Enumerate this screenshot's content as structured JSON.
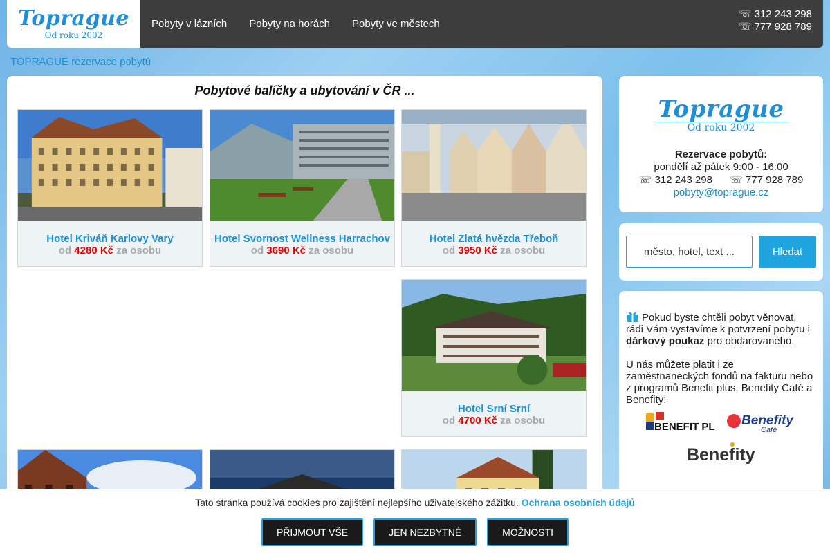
{
  "header": {
    "logo": {
      "word": "Toprague",
      "sub": "Od roku 2002"
    },
    "nav": [
      "Pobyty v lázních",
      "Pobyty na horách",
      "Pobyty ve městech"
    ],
    "phones": [
      "☏ 312 243 298",
      "☏ 777 928 789"
    ]
  },
  "breadcrumb": "TOPRAGUE rezervace pobytů",
  "main": {
    "title": "Pobytové balíčky a ubytování v ČR ...",
    "price_prefix": "od",
    "price_suffix": "za osobu",
    "cards": [
      {
        "name": "Hotel Kriváň Karlovy Vary",
        "price": "4280 Kč"
      },
      {
        "name": "Hotel Svornost Wellness Harrachov",
        "price": "3690 Kč"
      },
      {
        "name": "Hotel Zlatá hvězda Třeboň",
        "price": "3950 Kč"
      },
      {
        "name": "Hotel Srní Srní",
        "price": "4700 Kč"
      }
    ]
  },
  "sidebar": {
    "logo": {
      "word": "Toprague",
      "sub": "Od roku 2002"
    },
    "rez_title": "Rezervace pobytů:",
    "hours": "pondělí až pátek 9:00 - 16:00",
    "phones": "☏ 312 243 298      ☏ 777 928 789",
    "email": "pobyty@toprague.cz",
    "search": {
      "placeholder": "město, hotel, text ...",
      "button": "Hledat"
    },
    "info": {
      "p1_a": "Pokud byste chtěli pobyt věnovat, rádi Vám vystavíme k potvrzení pobytu i ",
      "p1_bold": "dárkový poukaz",
      "p1_b": " pro obdarovaného.",
      "p2": "U nás můžete platit i ze zaměstnaneckých fondů na fakturu nebo z programů Benefit plus, Benefity Café a Benefity:",
      "logos": {
        "benefit_plus": "BENEFIT PLUS",
        "benefity_cafe": "Benefity",
        "cafe_sub": "Café",
        "benefity": "Benefity"
      }
    }
  },
  "cookie": {
    "message": "Tato stránka používá cookies pro zajištění nejlepšího uživatelského zážitku.",
    "link": "Ochrana osobních údajů",
    "buttons": [
      "PŘIJMOUT VŠE",
      "JEN NEZBYTNÉ",
      "MOŽNOSTI"
    ]
  },
  "colors": {
    "accent": "#1fa4e0",
    "price": "#ee0000",
    "header_bg": "#3d3d3d"
  }
}
